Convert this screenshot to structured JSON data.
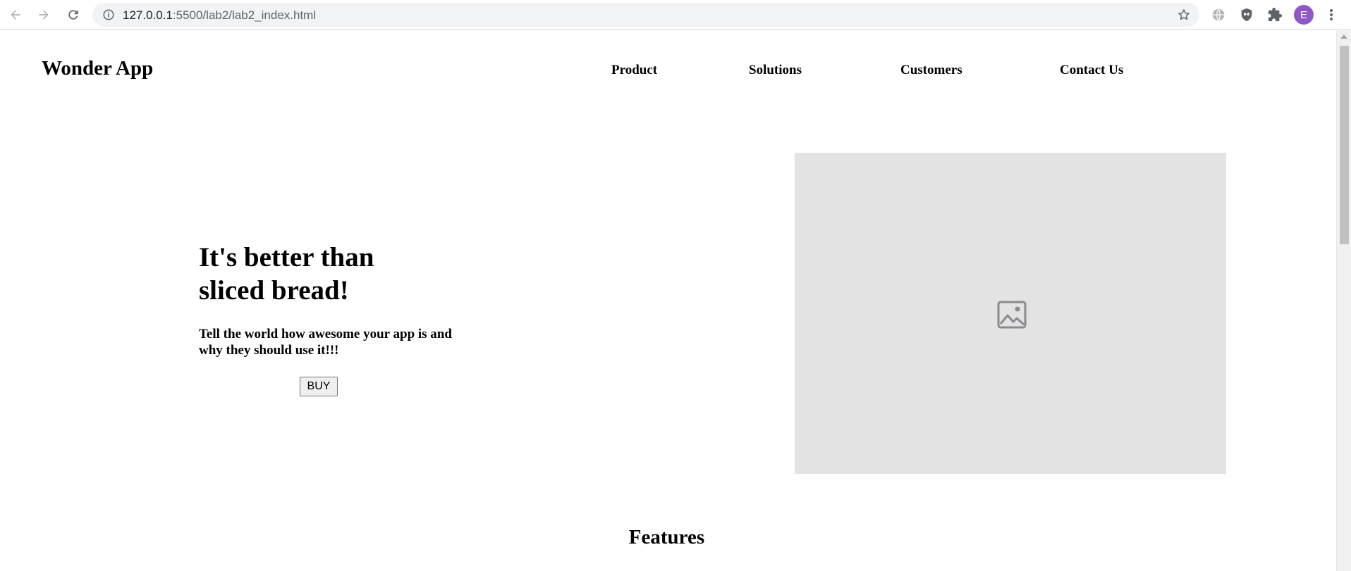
{
  "browser": {
    "url_host": "127.0.0.1",
    "url_rest": ":5500/lab2/lab2_index.html",
    "profile_initial": "E",
    "icons": [
      "back-icon",
      "forward-icon",
      "reload-icon",
      "info-icon",
      "star-icon",
      "globe-icon",
      "shield-icon",
      "puzzle-icon",
      "kebab-icon"
    ]
  },
  "header": {
    "brand": "Wonder App",
    "menu": [
      "Product",
      "Solutions",
      "Customers",
      "Contact Us"
    ]
  },
  "hero": {
    "title_line1": "It's better than",
    "title_line2": "sliced bread!",
    "subtitle_line1": "Tell the world how awesome your app is and",
    "subtitle_line2": "why they should use it!!!",
    "button": "BUY",
    "image_icon": "broken-image-icon"
  },
  "features": {
    "heading": "Features"
  },
  "colors": {
    "image_placeholder": "#e3e3e3",
    "profile": "#8e58c9"
  }
}
